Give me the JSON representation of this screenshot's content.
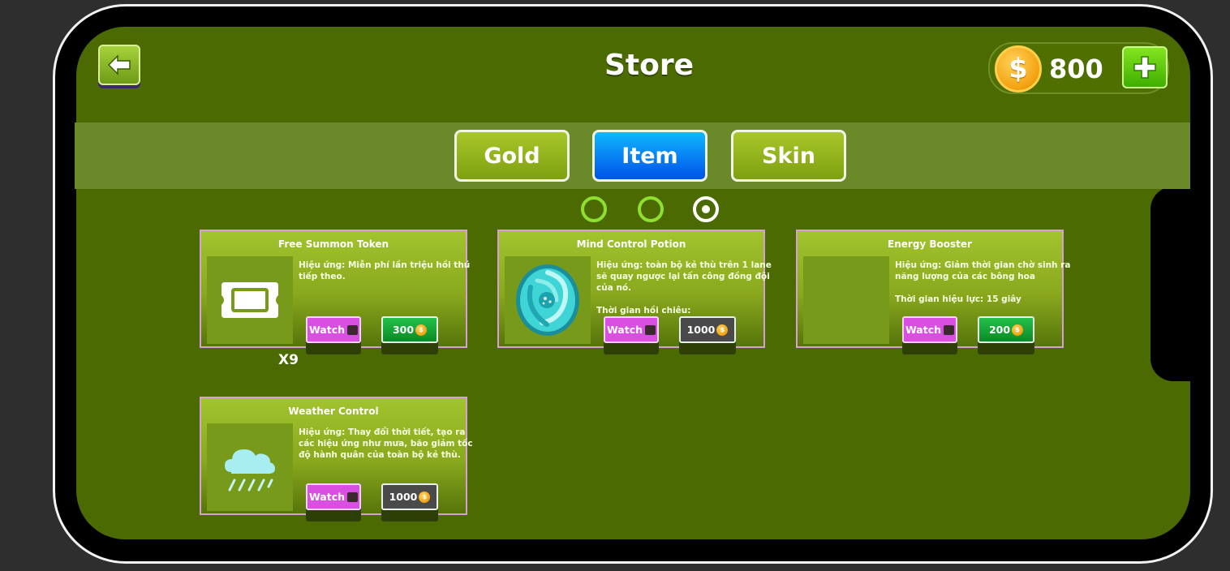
{
  "header": {
    "title": "Store",
    "coins": "800"
  },
  "tabs": [
    {
      "label": "Gold",
      "active": false
    },
    {
      "label": "Item",
      "active": true
    },
    {
      "label": "Skin",
      "active": false
    }
  ],
  "pagination": {
    "pages": 3,
    "current": 3
  },
  "items": [
    {
      "name": "Free Summon Token",
      "description": "Hiệu ứng: Miễn phí lần triệu hồi thú tiếp theo.",
      "count": "X9",
      "watch_label": "Watch",
      "price": "300",
      "price_style": "green",
      "icon": "ticket-icon"
    },
    {
      "name": "Mind Control Potion",
      "description": "Hiệu ứng: toàn bộ kẻ thù trên 1 lane sẽ quay ngược lại tấn công đồng đội của nó.\n\nThời gian hồi chiêu:",
      "watch_label": "Watch",
      "price": "1000",
      "price_style": "gray",
      "icon": "potion-swirl-icon"
    },
    {
      "name": "Energy Booster",
      "description": "Hiệu ứng: Giảm thời gian chờ sinh ra năng lượng của các bông hoa\n\nThời gian hiệu lực: 15 giây",
      "watch_label": "Watch",
      "price": "200",
      "price_style": "green",
      "icon": "empty"
    },
    {
      "name": "Weather Control",
      "description": "Hiệu ứng: Thay đổi thời tiết, tạo ra các hiệu ứng như mưa, bão giảm tốc độ hành quân của toàn bộ kẻ thù.",
      "watch_label": "Watch",
      "price": "1000",
      "price_style": "gray",
      "icon": "rain-cloud-icon"
    }
  ]
}
